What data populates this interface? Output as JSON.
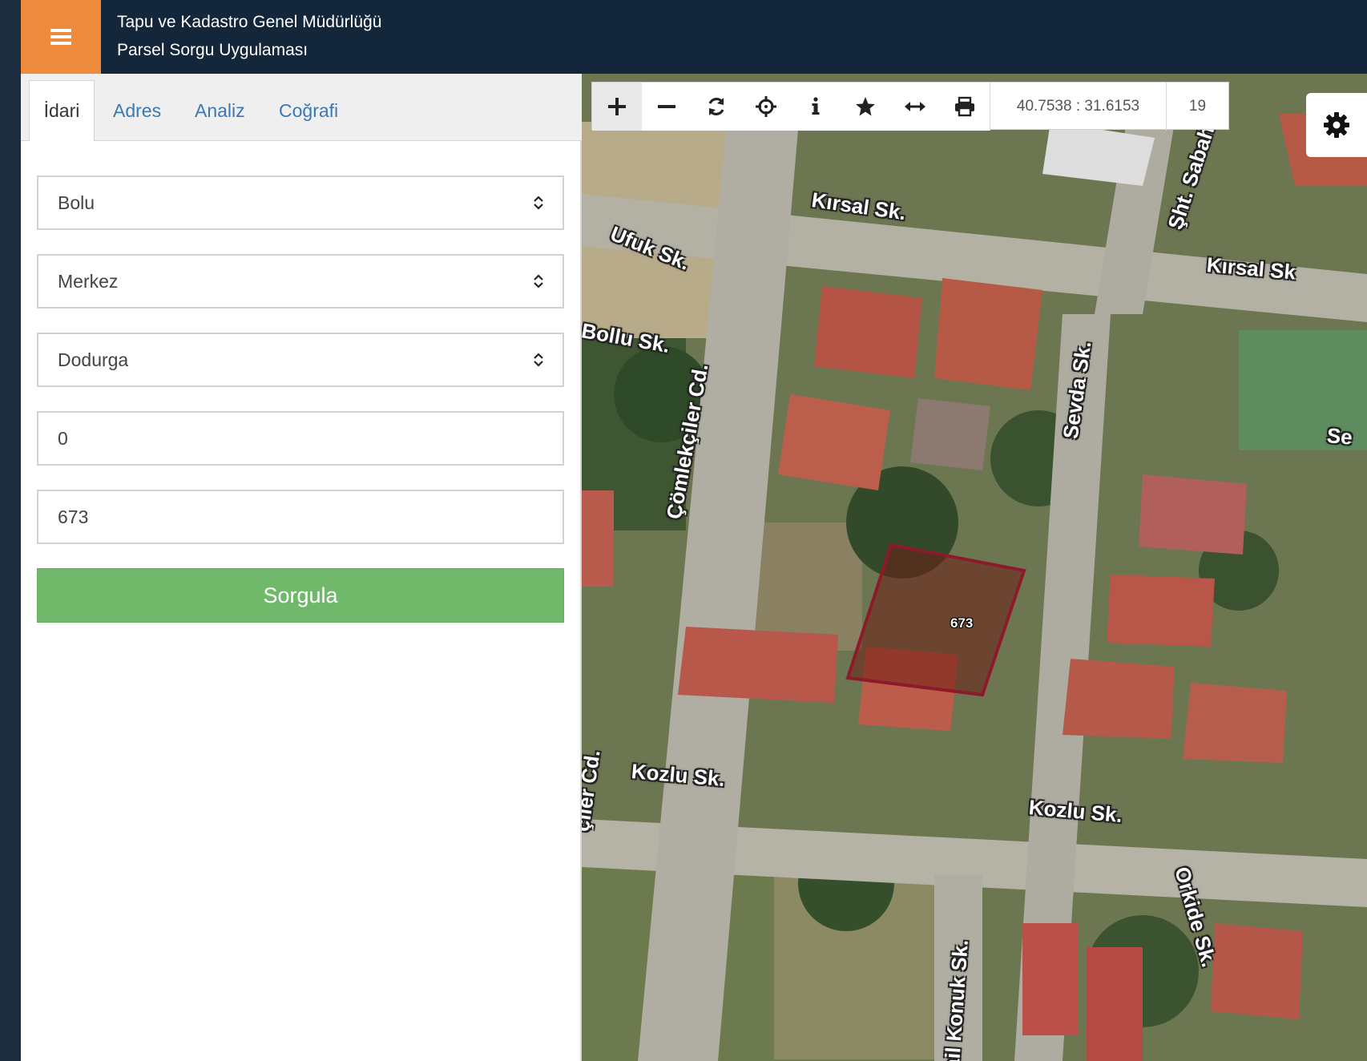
{
  "header": {
    "org_name": "Tapu ve Kadastro Genel Müdürlüğü",
    "app_name": "Parsel Sorgu Uygulaması",
    "accent_color": "#ee8a3c",
    "bar_color": "#13263a"
  },
  "tabs": [
    {
      "label": "İdari",
      "active": true
    },
    {
      "label": "Adres",
      "active": false
    },
    {
      "label": "Analiz",
      "active": false
    },
    {
      "label": "Coğrafi",
      "active": false
    }
  ],
  "form": {
    "province": "Bolu",
    "district": "Merkez",
    "neighborhood": "Dodurga",
    "block": "0",
    "parcel": "673",
    "submit_label": "Sorgula",
    "submit_color": "#71b96a"
  },
  "map": {
    "coordinates": "40.7538 : 31.6153",
    "zoom_level": "19",
    "parcel_label": "673",
    "tools": [
      "plus-icon",
      "minus-icon",
      "refresh-icon",
      "crosshair-icon",
      "info-icon",
      "star-icon",
      "measure-icon",
      "print-icon"
    ],
    "streets": [
      "Kırsal Sk.",
      "Ufuk Sk.",
      "Şht. Sabahatt",
      "Kırsal Sk",
      "Bollu Sk.",
      "Çömlekçiler Cd.",
      "Sevda Sk.",
      "Se",
      "Kozlu Sk.",
      "Kozlu Sk.",
      "çiler Cd.",
      "ail Konuk Sk.",
      "Orkide Sk."
    ]
  }
}
